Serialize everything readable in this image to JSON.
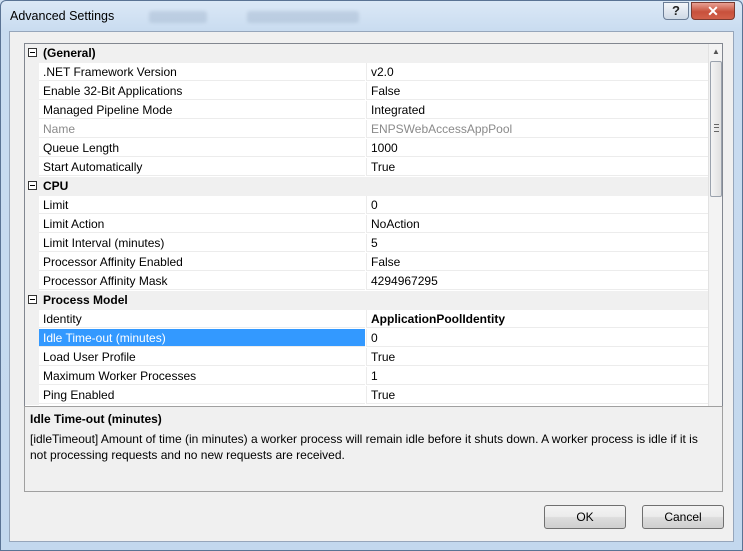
{
  "window": {
    "title": "Advanced Settings",
    "help_label": "?",
    "close_label": "✕"
  },
  "grid": {
    "categories": [
      {
        "label": "(General)",
        "rows": [
          {
            "name": ".NET Framework Version",
            "value": "v2.0"
          },
          {
            "name": "Enable 32-Bit Applications",
            "value": "False"
          },
          {
            "name": "Managed Pipeline Mode",
            "value": "Integrated"
          },
          {
            "name": "Name",
            "value": "ENPSWebAccessAppPool",
            "disabled": true
          },
          {
            "name": "Queue Length",
            "value": "1000"
          },
          {
            "name": "Start Automatically",
            "value": "True"
          }
        ]
      },
      {
        "label": "CPU",
        "rows": [
          {
            "name": "Limit",
            "value": "0"
          },
          {
            "name": "Limit Action",
            "value": "NoAction"
          },
          {
            "name": "Limit Interval (minutes)",
            "value": "5"
          },
          {
            "name": "Processor Affinity Enabled",
            "value": "False"
          },
          {
            "name": "Processor Affinity Mask",
            "value": "4294967295"
          }
        ]
      },
      {
        "label": "Process Model",
        "rows": [
          {
            "name": "Identity",
            "value": "ApplicationPoolIdentity",
            "bold": true
          },
          {
            "name": "Idle Time-out (minutes)",
            "value": "0",
            "selected": true
          },
          {
            "name": "Load User Profile",
            "value": "True"
          },
          {
            "name": "Maximum Worker Processes",
            "value": "1"
          },
          {
            "name": "Ping Enabled",
            "value": "True"
          }
        ]
      }
    ]
  },
  "description": {
    "title": "Idle Time-out (minutes)",
    "text": "[idleTimeout] Amount of time (in minutes) a worker process will remain idle before it shuts down. A worker process is idle if it is not processing requests and no new requests are received."
  },
  "buttons": {
    "ok_label": "OK",
    "cancel_label": "Cancel"
  }
}
